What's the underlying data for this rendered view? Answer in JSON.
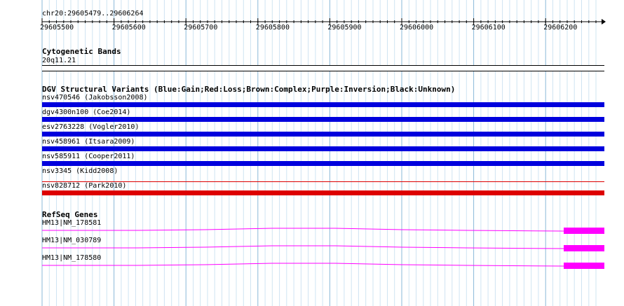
{
  "ruler": {
    "location": "chr20:29605479..29606264",
    "ticks": [
      "29605500",
      "29605600",
      "29605700",
      "29605800",
      "29605900",
      "29606000",
      "29606100",
      "29606200"
    ]
  },
  "cytoband": {
    "title": "Cytogenetic Bands",
    "band": "20q11.21"
  },
  "dgv": {
    "title": "DGV Structural Variants (Blue:Gain;Red:Loss;Brown:Complex;Purple:Inversion;Black:Unknown)",
    "variants": [
      {
        "label": "nsv470546 (Jakobsson2008)",
        "type": "gain",
        "color": "#0000dd"
      },
      {
        "label": "dgv4300n100 (Coe2014)",
        "type": "gain",
        "color": "#0000dd"
      },
      {
        "label": "esv2763228 (Vogler2010)",
        "type": "gain",
        "color": "#0000dd"
      },
      {
        "label": "nsv458961 (Itsara2009)",
        "type": "gain",
        "color": "#0000dd"
      },
      {
        "label": "nsv585911 (Cooper2011)",
        "type": "gain",
        "color": "#0000dd"
      },
      {
        "label": "nsv3345 (Kidd2008)",
        "type": "loss",
        "color": "#dd0000"
      },
      {
        "label": "nsv828712 (Park2010)",
        "type": "loss",
        "color": "#dd0000"
      }
    ]
  },
  "refseq": {
    "title": "RefSeq Genes",
    "color": "#ff00ff",
    "genes": [
      {
        "label": "HM13|NM_178581"
      },
      {
        "label": "HM13|NM_030789"
      },
      {
        "label": "HM13|NM_178580"
      }
    ]
  }
}
